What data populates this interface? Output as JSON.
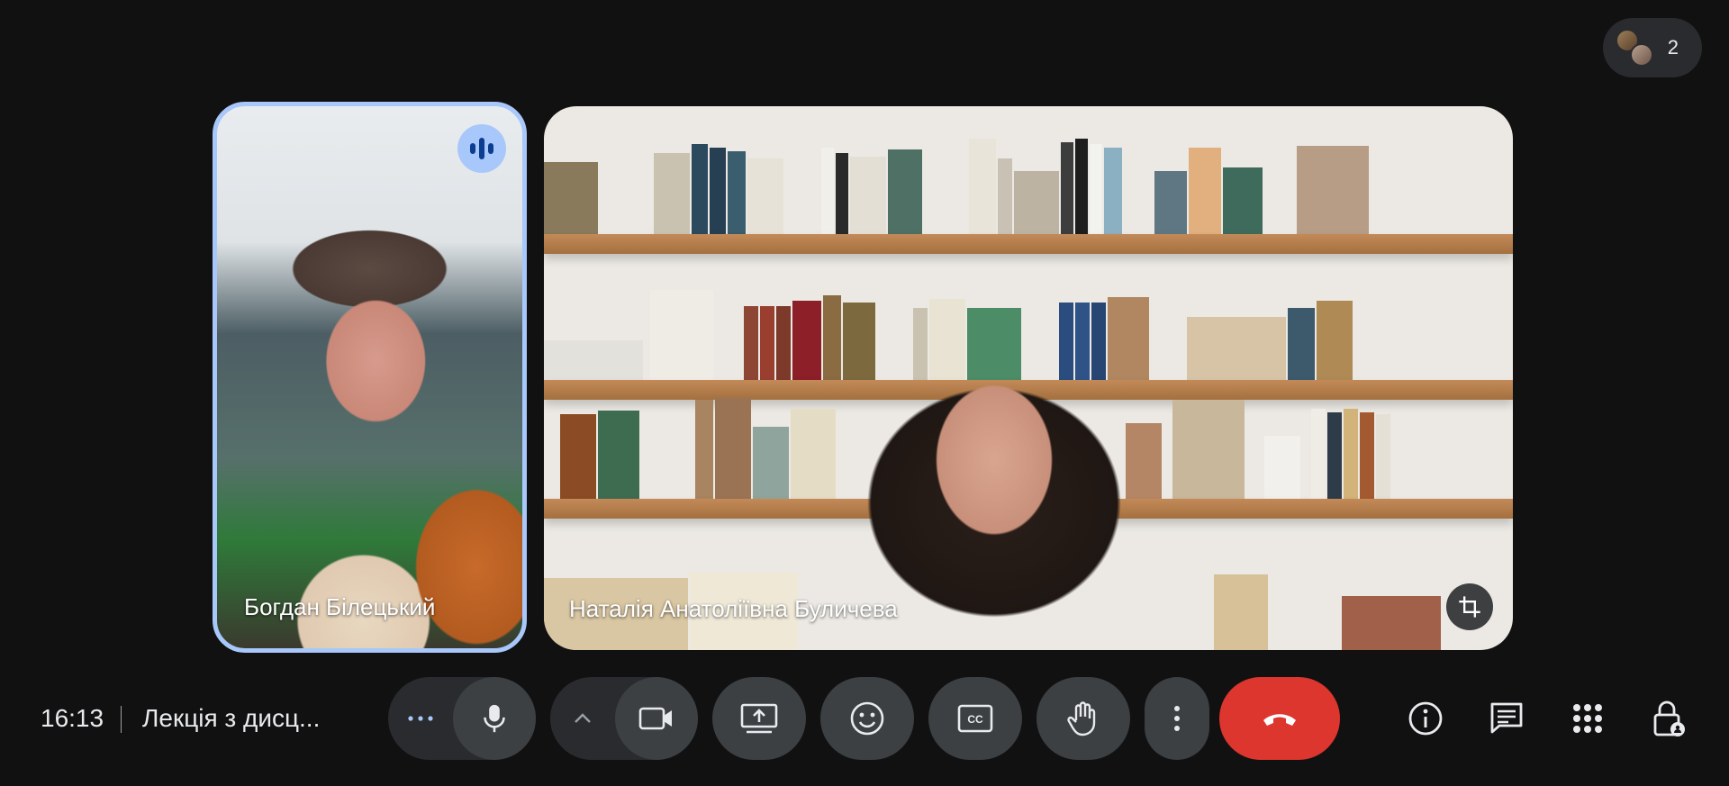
{
  "participants": {
    "count": "2",
    "icon": "people-avatars-icon"
  },
  "tiles": [
    {
      "name": "Богдан Білецький",
      "speaking": true
    },
    {
      "name": "Наталія Анатоліївна Буличева",
      "speaking": false
    }
  ],
  "bottombar": {
    "time": "16:13",
    "meeting_title": "Лекція з дисц...",
    "controls": [
      {
        "icon": "more-options-horizontal-icon"
      },
      {
        "icon": "microphone-icon"
      },
      {
        "icon": "chevron-up-icon"
      },
      {
        "icon": "camera-icon"
      },
      {
        "icon": "present-screen-icon"
      },
      {
        "icon": "emoji-icon"
      },
      {
        "icon": "captions-icon"
      },
      {
        "icon": "raise-hand-icon"
      },
      {
        "icon": "more-vertical-icon"
      },
      {
        "icon": "end-call-icon"
      }
    ],
    "right_icons": [
      {
        "icon": "info-icon"
      },
      {
        "icon": "chat-icon"
      },
      {
        "icon": "activities-icon"
      },
      {
        "icon": "host-controls-lock-icon"
      }
    ]
  },
  "colors": {
    "background": "#111111",
    "speaking_border": "#a8c7fa",
    "end_call": "#dc362e",
    "control_bg": "#3c4043"
  }
}
